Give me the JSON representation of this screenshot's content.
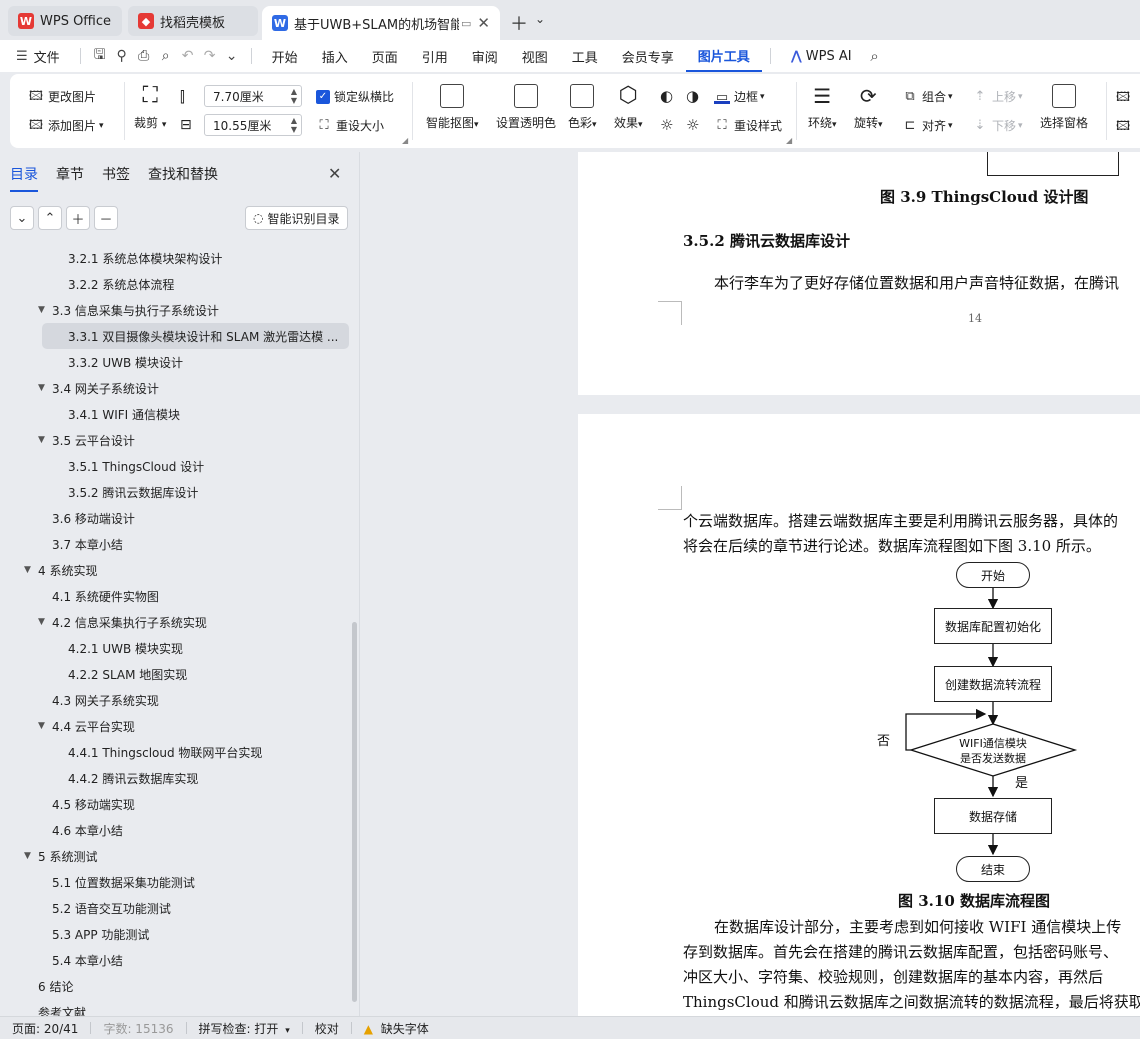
{
  "tabs": [
    {
      "label": "WPS Office",
      "icon": "wps-logo-icon",
      "color": "#e53935"
    },
    {
      "label": "找稻壳模板",
      "icon": "docer-icon",
      "color": "#e53935"
    },
    {
      "label": "基于UWB+SLAM的机场智能行",
      "icon": "writer-icon",
      "color": "#2f6ae5"
    }
  ],
  "menu": {
    "file": "文件",
    "items": [
      "开始",
      "插入",
      "页面",
      "引用",
      "审阅",
      "视图",
      "工具",
      "会员专享",
      "图片工具"
    ],
    "active": "图片工具",
    "wps_ai": "WPS AI"
  },
  "ribbon": {
    "change_picture": "更改图片",
    "add_picture": "添加图片",
    "crop": "裁剪",
    "height_value": "7.70厘米",
    "width_value": "10.55厘米",
    "lock_ratio": "锁定纵横比",
    "reset_size": "重设大小",
    "smart_cutout": "智能抠图",
    "set_transparent": "设置透明色",
    "color": "色彩",
    "effects": "效果",
    "border": "边框",
    "reset_style": "重设样式",
    "wrap": "环绕",
    "rotate": "旋转",
    "group": "组合",
    "align": "对齐",
    "move_up": "上移",
    "move_down": "下移",
    "selection_pane": "选择窗格"
  },
  "sidebar": {
    "tabs": [
      "目录",
      "章节",
      "书签",
      "查找和替换"
    ],
    "smart_toc": "智能识别目录",
    "toc": [
      {
        "text": "3.2.1  系统总体模块架构设计",
        "level": 3,
        "caret": false
      },
      {
        "text": "3.2.2  系统总体流程",
        "level": 3,
        "caret": false
      },
      {
        "text": "3.3 信息采集与执行子系统设计",
        "level": 2,
        "caret": true
      },
      {
        "text": "3.3.1  双目摄像头模块设计和 SLAM 激光雷达模 ...",
        "level": 3,
        "caret": false,
        "selected": true
      },
      {
        "text": "3.3.2 UWB 模块设计",
        "level": 3,
        "caret": false
      },
      {
        "text": "3.4 网关子系统设计",
        "level": 2,
        "caret": true
      },
      {
        "text": "3.4.1 WIFI 通信模块",
        "level": 3,
        "caret": false
      },
      {
        "text": "3.5 云平台设计",
        "level": 2,
        "caret": true
      },
      {
        "text": "3.5.1 ThingsCloud 设计",
        "level": 3,
        "caret": false
      },
      {
        "text": "3.5.2  腾讯云数据库设计",
        "level": 3,
        "caret": false
      },
      {
        "text": "3.6 移动端设计",
        "level": 2,
        "caret": false
      },
      {
        "text": "3.7 本章小结",
        "level": 2,
        "caret": false
      },
      {
        "text": "4  系统实现",
        "level": 1,
        "caret": true
      },
      {
        "text": "4.1 系统硬件实物图",
        "level": 2,
        "caret": false
      },
      {
        "text": "4.2 信息采集执行子系统实现",
        "level": 2,
        "caret": true
      },
      {
        "text": "4.2.1 UWB 模块实现",
        "level": 3,
        "caret": false
      },
      {
        "text": "4.2.2 SLAM 地图实现",
        "level": 3,
        "caret": false
      },
      {
        "text": "4.3 网关子系统实现",
        "level": 2,
        "caret": false
      },
      {
        "text": "4.4  云平台实现",
        "level": 2,
        "caret": true
      },
      {
        "text": "4.4.1 Thingscloud 物联网平台实现",
        "level": 3,
        "caret": false
      },
      {
        "text": "4.4.2  腾讯云数据库实现",
        "level": 3,
        "caret": false
      },
      {
        "text": "4.5  移动端实现",
        "level": 2,
        "caret": false
      },
      {
        "text": "4.6  本章小结",
        "level": 2,
        "caret": false
      },
      {
        "text": "5  系统测试",
        "level": 1,
        "caret": true
      },
      {
        "text": "5.1  位置数据采集功能测试",
        "level": 2,
        "caret": false
      },
      {
        "text": "5.2  语音交互功能测试",
        "level": 2,
        "caret": false
      },
      {
        "text": "5.3 APP 功能测试",
        "level": 2,
        "caret": false
      },
      {
        "text": "5.4  本章小结",
        "level": 2,
        "caret": false
      },
      {
        "text": "6  结论",
        "level": 1,
        "caret": false
      },
      {
        "text": "参考文献",
        "level": 1,
        "caret": false
      }
    ]
  },
  "document": {
    "fig39_caption": "图 3.9 ThingsCloud 设计图",
    "section_352": "3.5.2  腾讯云数据库设计",
    "para1": "本行李车为了更好存储位置数据和用户声音特征数据，在腾讯",
    "page_number": "14",
    "line2a": "个云端数据库。搭建云端数据库主要是利用腾讯云服务器，具体的",
    "line2b": "将会在后续的章节进行论述。数据库流程图如下图 3.10 所示。",
    "flow": {
      "start": "开始",
      "init": "数据库配置初始化",
      "create": "创建数据流转流程",
      "decision_line1": "WIFI通信模块",
      "decision_line2": "是否发送数据",
      "no": "否",
      "yes": "是",
      "store": "数据存储",
      "end": "结束"
    },
    "fig310_caption": "图 3.10  数据库流程图",
    "para3a": "在数据库设计部分，主要考虑到如何接收 WIFI 通信模块上传",
    "para3b": "存到数据库。首先会在搭建的腾讯云数据库配置，包括密码账号、",
    "para3c": "冲区大小、字符集、校验规则，创建数据库的基本内容，再然后",
    "para3d": "ThingsCloud 和腾讯云数据库之间数据流转的数据流程，最后将获取"
  },
  "status": {
    "page": "页面: 20/41",
    "words": "字数: 15136",
    "spell": "拼写检查: 打开",
    "proof": "校对",
    "missing_font": "缺失字体"
  }
}
